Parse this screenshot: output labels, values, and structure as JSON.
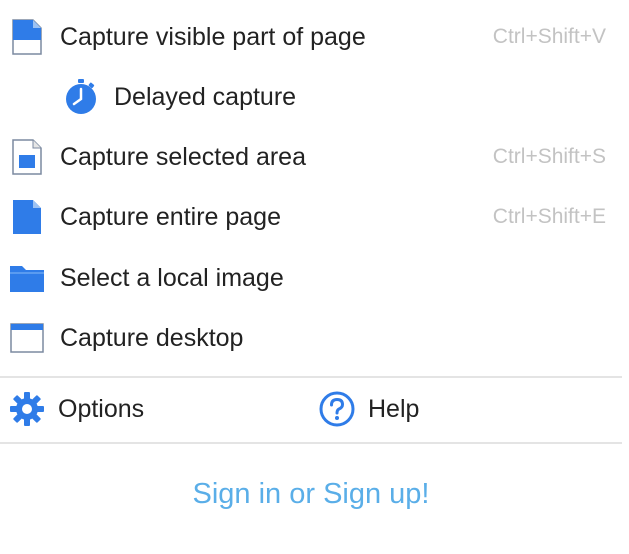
{
  "menu": {
    "items": [
      {
        "label": "Capture visible part of page",
        "shortcut": "Ctrl+Shift+V",
        "icon": "visible-page-icon"
      },
      {
        "label": "Delayed capture",
        "shortcut": "",
        "icon": "timer-icon"
      },
      {
        "label": "Capture selected area",
        "shortcut": "Ctrl+Shift+S",
        "icon": "selected-area-icon"
      },
      {
        "label": "Capture entire page",
        "shortcut": "Ctrl+Shift+E",
        "icon": "entire-page-icon"
      },
      {
        "label": "Select a local image",
        "shortcut": "",
        "icon": "folder-icon"
      },
      {
        "label": "Capture desktop",
        "shortcut": "",
        "icon": "desktop-window-icon"
      }
    ],
    "options_label": "Options",
    "help_label": "Help",
    "signin_label": "Sign in or Sign up!"
  },
  "colors": {
    "accent": "#2f7ce8",
    "shortcut": "#c3c3c3",
    "link": "#5aaee8"
  }
}
